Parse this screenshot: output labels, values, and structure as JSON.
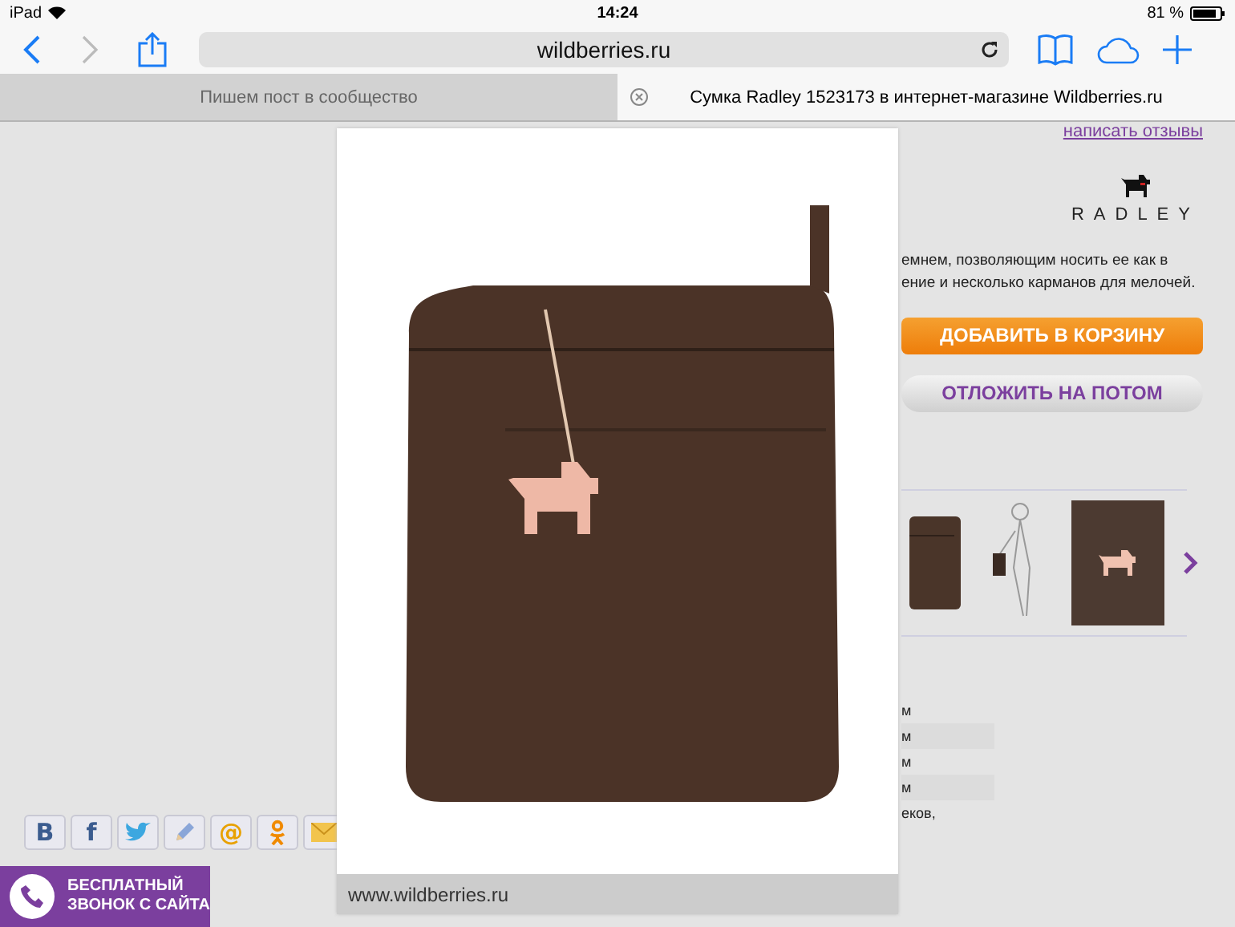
{
  "status_bar": {
    "device": "iPad",
    "time": "14:24",
    "battery": "81 %"
  },
  "toolbar": {
    "address": "wildberries.ru"
  },
  "tabs": [
    {
      "title": "Пишем пост в сообщество",
      "selected": false
    },
    {
      "title": "Сумка Radley 1523173 в интернет-магазине Wildberries.ru",
      "selected": true
    }
  ],
  "product": {
    "review_link": "написать отзывы",
    "brand": "RADLEY",
    "description": [
      "емнем, позволяющим носить ее как в",
      "ение и несколько карманов для мелочей."
    ],
    "buttons": [
      {
        "label": "ДОБАВИТЬ В КОРЗИНУ",
        "kind": "primary"
      },
      {
        "label": "ОТЛОЖИТЬ НА ПОТОМ",
        "kind": "secondary"
      }
    ],
    "specs": [
      "м",
      "м",
      "м",
      "м",
      "еков,"
    ]
  },
  "share_buttons": [
    {
      "kind": "letter",
      "glyph": "B"
    },
    {
      "kind": "letter",
      "glyph": "f"
    },
    {
      "kind": "bird"
    },
    {
      "kind": "pencil"
    },
    {
      "kind": "letter",
      "glyph": "@"
    },
    {
      "kind": "person"
    },
    {
      "kind": "envelope"
    }
  ],
  "call_banner": {
    "lines": [
      "БЕСПЛАТНЫЙ",
      "ЗВОНОК С САЙТА"
    ]
  },
  "photo_viewer": {
    "caption": "www.wildberries.ru"
  }
}
